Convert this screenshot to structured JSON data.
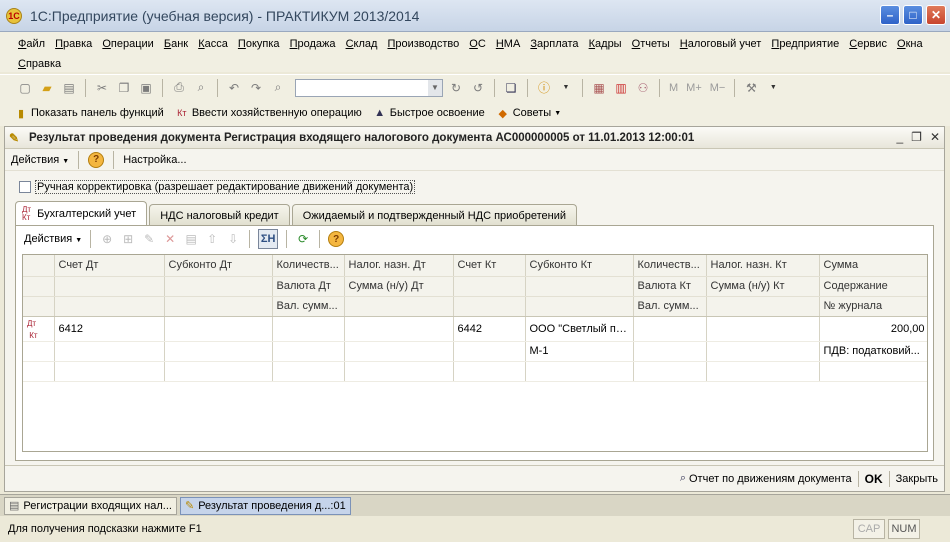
{
  "window": {
    "title": "1С:Предприятие (учебная версия) - ПРАКТИКУМ 2013/2014",
    "app_icon": "1С"
  },
  "menu": [
    "Файл",
    "Правка",
    "Операции",
    "Банк",
    "Касса",
    "Покупка",
    "Продажа",
    "Склад",
    "Производство",
    "ОС",
    "НМА",
    "Зарплата",
    "Кадры",
    "Отчеты",
    "Налоговый учет",
    "Предприятие",
    "Сервис",
    "Окна",
    "Справка"
  ],
  "toolbar1": {
    "search_value": "",
    "m": "M",
    "m_plus": "M+",
    "m_minus": "M−"
  },
  "toolbar2": {
    "show_panel": "Показать панель функций",
    "enter_operation": "Ввести хозяйственную операцию",
    "quick_learning": "Быстрое освоение",
    "tips": "Советы"
  },
  "document": {
    "title": "Результат проведения документа Регистрация входящего налогового документа АС000000005 от 11.01.2013 12:00:01",
    "actions_label": "Действия",
    "settings_label": "Настройка...",
    "manual_correction_label": "Ручная корректировка (разрешает редактирование движений документа)",
    "manual_correction_checked": false,
    "tabs": [
      {
        "label": "Бухгалтерский учет",
        "icon": "Дт\nКт",
        "active": true
      },
      {
        "label": "НДС налоговый кредит",
        "active": false
      },
      {
        "label": "Ожидаемый и подтвержденный НДС приобретений",
        "active": false
      }
    ],
    "panel_actions_label": "Действия",
    "sum_button": "ΣН",
    "grid": {
      "header_row1": [
        "",
        "Счет Дт",
        "Субконто Дт",
        "Количеств...",
        "Налог. назн. Дт",
        "Счет Кт",
        "Субконто Кт",
        "Количеств...",
        "Налог. назн. Кт",
        "Сумма"
      ],
      "header_row2": [
        "",
        "",
        "",
        "Валюта Дт",
        "Сумма (н/у) Дт",
        "",
        "",
        "Валюта Кт",
        "Сумма (н/у) Кт",
        "Содержание"
      ],
      "header_row3": [
        "",
        "",
        "",
        "Вал. сумм...",
        "",
        "",
        "",
        "Вал. сумм...",
        "",
        "№ журнала"
      ],
      "rows": [
        {
          "icon": "Дт Кт",
          "line1": [
            "6412",
            "",
            "",
            "",
            "6442",
            "ООО \"Светлый пу...",
            "",
            "",
            "200,00"
          ],
          "line2": [
            "",
            "",
            "",
            "",
            "",
            "М-1",
            "",
            "",
            "ПДВ: податковий..."
          ],
          "line3": [
            "",
            "",
            "",
            "",
            "",
            "",
            "",
            "",
            ""
          ]
        }
      ]
    },
    "bottom": {
      "report_label": "Отчет по движениям документа",
      "ok_label": "OK",
      "close_label": "Закрыть"
    }
  },
  "taskbar": [
    {
      "label": "Регистрации входящих нал...",
      "active": false
    },
    {
      "label": "Результат проведения д...:01",
      "active": true
    }
  ],
  "status": {
    "hint": "Для получения подсказки нажмите F1",
    "cap": "CAP",
    "num": "NUM"
  }
}
